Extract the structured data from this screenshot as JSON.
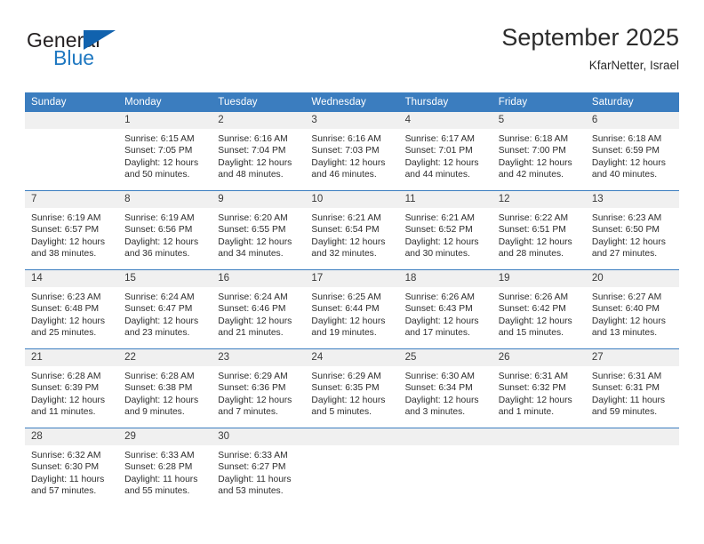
{
  "brand": {
    "name_top": "General",
    "name_bottom": "Blue",
    "logo_icon": "triangle-icon",
    "color_dark": "#231f20",
    "color_blue": "#1f78c1",
    "color_triangle": "#1162ae"
  },
  "header": {
    "title": "September 2025",
    "location": "KfarNetter, Israel"
  },
  "calendar": {
    "header_bg": "#3b7dbf",
    "daynum_bg": "#f0f0f0",
    "weekdays": [
      "Sunday",
      "Monday",
      "Tuesday",
      "Wednesday",
      "Thursday",
      "Friday",
      "Saturday"
    ],
    "weeks": [
      [
        {
          "day": "",
          "empty": true,
          "sunrise": "",
          "sunset": "",
          "daylight1": "",
          "daylight2": ""
        },
        {
          "day": "1",
          "sunrise": "Sunrise: 6:15 AM",
          "sunset": "Sunset: 7:05 PM",
          "daylight1": "Daylight: 12 hours",
          "daylight2": "and 50 minutes."
        },
        {
          "day": "2",
          "sunrise": "Sunrise: 6:16 AM",
          "sunset": "Sunset: 7:04 PM",
          "daylight1": "Daylight: 12 hours",
          "daylight2": "and 48 minutes."
        },
        {
          "day": "3",
          "sunrise": "Sunrise: 6:16 AM",
          "sunset": "Sunset: 7:03 PM",
          "daylight1": "Daylight: 12 hours",
          "daylight2": "and 46 minutes."
        },
        {
          "day": "4",
          "sunrise": "Sunrise: 6:17 AM",
          "sunset": "Sunset: 7:01 PM",
          "daylight1": "Daylight: 12 hours",
          "daylight2": "and 44 minutes."
        },
        {
          "day": "5",
          "sunrise": "Sunrise: 6:18 AM",
          "sunset": "Sunset: 7:00 PM",
          "daylight1": "Daylight: 12 hours",
          "daylight2": "and 42 minutes."
        },
        {
          "day": "6",
          "sunrise": "Sunrise: 6:18 AM",
          "sunset": "Sunset: 6:59 PM",
          "daylight1": "Daylight: 12 hours",
          "daylight2": "and 40 minutes."
        }
      ],
      [
        {
          "day": "7",
          "sunrise": "Sunrise: 6:19 AM",
          "sunset": "Sunset: 6:57 PM",
          "daylight1": "Daylight: 12 hours",
          "daylight2": "and 38 minutes."
        },
        {
          "day": "8",
          "sunrise": "Sunrise: 6:19 AM",
          "sunset": "Sunset: 6:56 PM",
          "daylight1": "Daylight: 12 hours",
          "daylight2": "and 36 minutes."
        },
        {
          "day": "9",
          "sunrise": "Sunrise: 6:20 AM",
          "sunset": "Sunset: 6:55 PM",
          "daylight1": "Daylight: 12 hours",
          "daylight2": "and 34 minutes."
        },
        {
          "day": "10",
          "sunrise": "Sunrise: 6:21 AM",
          "sunset": "Sunset: 6:54 PM",
          "daylight1": "Daylight: 12 hours",
          "daylight2": "and 32 minutes."
        },
        {
          "day": "11",
          "sunrise": "Sunrise: 6:21 AM",
          "sunset": "Sunset: 6:52 PM",
          "daylight1": "Daylight: 12 hours",
          "daylight2": "and 30 minutes."
        },
        {
          "day": "12",
          "sunrise": "Sunrise: 6:22 AM",
          "sunset": "Sunset: 6:51 PM",
          "daylight1": "Daylight: 12 hours",
          "daylight2": "and 28 minutes."
        },
        {
          "day": "13",
          "sunrise": "Sunrise: 6:23 AM",
          "sunset": "Sunset: 6:50 PM",
          "daylight1": "Daylight: 12 hours",
          "daylight2": "and 27 minutes."
        }
      ],
      [
        {
          "day": "14",
          "sunrise": "Sunrise: 6:23 AM",
          "sunset": "Sunset: 6:48 PM",
          "daylight1": "Daylight: 12 hours",
          "daylight2": "and 25 minutes."
        },
        {
          "day": "15",
          "sunrise": "Sunrise: 6:24 AM",
          "sunset": "Sunset: 6:47 PM",
          "daylight1": "Daylight: 12 hours",
          "daylight2": "and 23 minutes."
        },
        {
          "day": "16",
          "sunrise": "Sunrise: 6:24 AM",
          "sunset": "Sunset: 6:46 PM",
          "daylight1": "Daylight: 12 hours",
          "daylight2": "and 21 minutes."
        },
        {
          "day": "17",
          "sunrise": "Sunrise: 6:25 AM",
          "sunset": "Sunset: 6:44 PM",
          "daylight1": "Daylight: 12 hours",
          "daylight2": "and 19 minutes."
        },
        {
          "day": "18",
          "sunrise": "Sunrise: 6:26 AM",
          "sunset": "Sunset: 6:43 PM",
          "daylight1": "Daylight: 12 hours",
          "daylight2": "and 17 minutes."
        },
        {
          "day": "19",
          "sunrise": "Sunrise: 6:26 AM",
          "sunset": "Sunset: 6:42 PM",
          "daylight1": "Daylight: 12 hours",
          "daylight2": "and 15 minutes."
        },
        {
          "day": "20",
          "sunrise": "Sunrise: 6:27 AM",
          "sunset": "Sunset: 6:40 PM",
          "daylight1": "Daylight: 12 hours",
          "daylight2": "and 13 minutes."
        }
      ],
      [
        {
          "day": "21",
          "sunrise": "Sunrise: 6:28 AM",
          "sunset": "Sunset: 6:39 PM",
          "daylight1": "Daylight: 12 hours",
          "daylight2": "and 11 minutes."
        },
        {
          "day": "22",
          "sunrise": "Sunrise: 6:28 AM",
          "sunset": "Sunset: 6:38 PM",
          "daylight1": "Daylight: 12 hours",
          "daylight2": "and 9 minutes."
        },
        {
          "day": "23",
          "sunrise": "Sunrise: 6:29 AM",
          "sunset": "Sunset: 6:36 PM",
          "daylight1": "Daylight: 12 hours",
          "daylight2": "and 7 minutes."
        },
        {
          "day": "24",
          "sunrise": "Sunrise: 6:29 AM",
          "sunset": "Sunset: 6:35 PM",
          "daylight1": "Daylight: 12 hours",
          "daylight2": "and 5 minutes."
        },
        {
          "day": "25",
          "sunrise": "Sunrise: 6:30 AM",
          "sunset": "Sunset: 6:34 PM",
          "daylight1": "Daylight: 12 hours",
          "daylight2": "and 3 minutes."
        },
        {
          "day": "26",
          "sunrise": "Sunrise: 6:31 AM",
          "sunset": "Sunset: 6:32 PM",
          "daylight1": "Daylight: 12 hours",
          "daylight2": "and 1 minute."
        },
        {
          "day": "27",
          "sunrise": "Sunrise: 6:31 AM",
          "sunset": "Sunset: 6:31 PM",
          "daylight1": "Daylight: 11 hours",
          "daylight2": "and 59 minutes."
        }
      ],
      [
        {
          "day": "28",
          "sunrise": "Sunrise: 6:32 AM",
          "sunset": "Sunset: 6:30 PM",
          "daylight1": "Daylight: 11 hours",
          "daylight2": "and 57 minutes."
        },
        {
          "day": "29",
          "sunrise": "Sunrise: 6:33 AM",
          "sunset": "Sunset: 6:28 PM",
          "daylight1": "Daylight: 11 hours",
          "daylight2": "and 55 minutes."
        },
        {
          "day": "30",
          "sunrise": "Sunrise: 6:33 AM",
          "sunset": "Sunset: 6:27 PM",
          "daylight1": "Daylight: 11 hours",
          "daylight2": "and 53 minutes."
        },
        {
          "day": "",
          "empty": true,
          "sunrise": "",
          "sunset": "",
          "daylight1": "",
          "daylight2": ""
        },
        {
          "day": "",
          "empty": true,
          "sunrise": "",
          "sunset": "",
          "daylight1": "",
          "daylight2": ""
        },
        {
          "day": "",
          "empty": true,
          "sunrise": "",
          "sunset": "",
          "daylight1": "",
          "daylight2": ""
        },
        {
          "day": "",
          "empty": true,
          "sunrise": "",
          "sunset": "",
          "daylight1": "",
          "daylight2": ""
        }
      ]
    ]
  }
}
